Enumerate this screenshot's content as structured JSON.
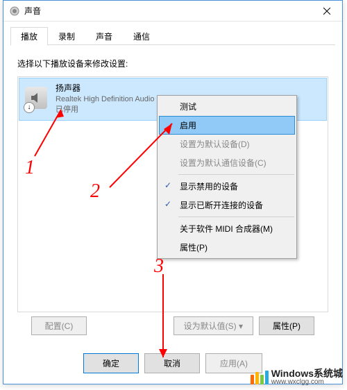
{
  "window": {
    "title": "声音"
  },
  "tabs": [
    {
      "label": "播放",
      "active": true
    },
    {
      "label": "录制",
      "active": false
    },
    {
      "label": "声音",
      "active": false
    },
    {
      "label": "通信",
      "active": false
    }
  ],
  "instruction": "选择以下播放设备来修改设置:",
  "device": {
    "name": "扬声器",
    "desc": "Realtek High Definition Audio",
    "status": "已停用"
  },
  "context_menu": {
    "items": [
      {
        "label": "测试",
        "type": "normal"
      },
      {
        "label": "启用",
        "type": "highlight"
      },
      {
        "label": "设置为默认设备(D)",
        "type": "disabled"
      },
      {
        "label": "设置为默认通信设备(C)",
        "type": "disabled"
      },
      {
        "type": "sep"
      },
      {
        "label": "显示禁用的设备",
        "type": "checked"
      },
      {
        "label": "显示已断开连接的设备",
        "type": "checked"
      },
      {
        "type": "sep"
      },
      {
        "label": "关于软件 MIDI 合成器(M)",
        "type": "normal"
      },
      {
        "label": "属性(P)",
        "type": "normal"
      }
    ]
  },
  "buttons": {
    "configure": "配置(C)",
    "set_default": "设为默认值(S)  ▾",
    "properties": "属性(P)",
    "ok": "确定",
    "cancel": "取消",
    "apply": "应用(A)"
  },
  "annotations": {
    "n1": "1",
    "n2": "2",
    "n3": "3"
  },
  "watermark": {
    "brand": "Windows系统城",
    "url": "www.wxclgg.com"
  }
}
